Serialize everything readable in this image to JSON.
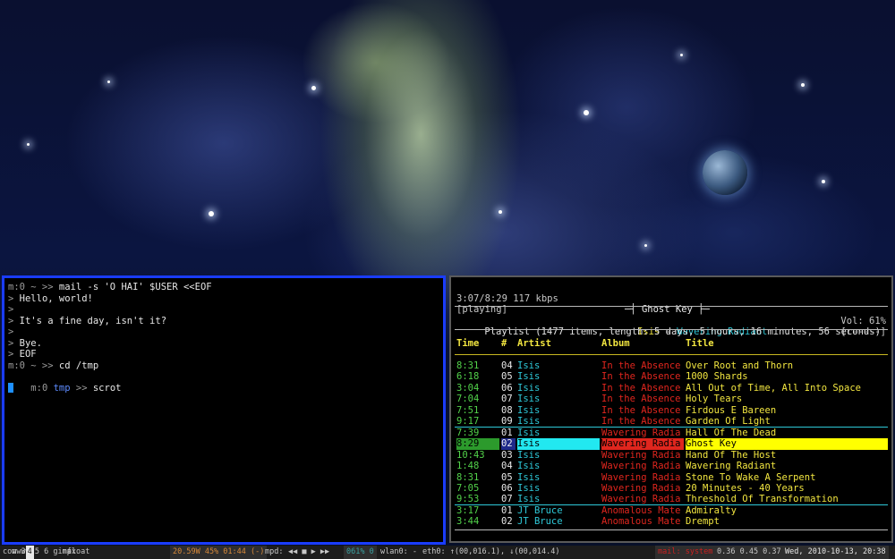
{
  "terminal": {
    "lines": [
      {
        "prompt": "m:0 ~ >> ",
        "text": "mail -s 'O HAI' $USER <<EOF"
      },
      {
        "prompt": "> ",
        "text": "Hello, world!"
      },
      {
        "prompt": ">",
        "text": ""
      },
      {
        "prompt": "> ",
        "text": "It's a fine day, isn't it?"
      },
      {
        "prompt": ">",
        "text": ""
      },
      {
        "prompt": "> ",
        "text": "Bye."
      },
      {
        "prompt": "> ",
        "text": "EOF"
      },
      {
        "prompt": "m:0 ~ >> ",
        "text": "cd /tmp"
      }
    ],
    "last_prompt_pre": "m:0 ",
    "last_prompt_dir": "tmp",
    "last_prompt_post": " >> ",
    "last_command": "scrot"
  },
  "player": {
    "elapsed": "3:07/8:29 117 kbps",
    "song_title": "─┤ Ghost Key ├─",
    "volume": "Vol: 61%",
    "state": "[playing]",
    "now_artist": "Isis",
    "now_sep": " - ",
    "now_album": "Wavering Radiant",
    "flags": "[r-----]",
    "playlist_info": "Playlist (1477 items, length: 5 days, 5 hours, 16 minutes, 56 seconds)",
    "columns": {
      "time": "Time",
      "num": "#",
      "artist": "Artist",
      "album": "Album",
      "title": "Title"
    },
    "rows": [
      {
        "time": "8:31",
        "num": "04",
        "artist": "Isis",
        "album": "In the Absence",
        "title": "Over Root and Thorn"
      },
      {
        "time": "6:18",
        "num": "05",
        "artist": "Isis",
        "album": "In the Absence",
        "title": "1000 Shards"
      },
      {
        "time": "3:04",
        "num": "06",
        "artist": "Isis",
        "album": "In the Absence",
        "title": "All Out of Time, All Into Space"
      },
      {
        "time": "7:04",
        "num": "07",
        "artist": "Isis",
        "album": "In the Absence",
        "title": "Holy Tears"
      },
      {
        "time": "7:51",
        "num": "08",
        "artist": "Isis",
        "album": "In the Absence",
        "title": "Firdous E Bareen"
      },
      {
        "time": "9:17",
        "num": "09",
        "artist": "Isis",
        "album": "In the Absence",
        "title": "Garden Of Light"
      },
      {
        "time": "7:39",
        "num": "01",
        "artist": "Isis",
        "album": "Wavering Radia",
        "title": "Hall Of The Dead"
      },
      {
        "time": "8:29",
        "num": "02",
        "artist": "Isis",
        "album": "Wavering Radia",
        "title": "Ghost Key"
      },
      {
        "time": "10:43",
        "num": "03",
        "artist": "Isis",
        "album": "Wavering Radia",
        "title": "Hand Of The Host"
      },
      {
        "time": "1:48",
        "num": "04",
        "artist": "Isis",
        "album": "Wavering Radia",
        "title": "Wavering Radiant"
      },
      {
        "time": "8:31",
        "num": "05",
        "artist": "Isis",
        "album": "Wavering Radia",
        "title": "Stone To Wake A Serpent"
      },
      {
        "time": "7:05",
        "num": "06",
        "artist": "Isis",
        "album": "Wavering Radia",
        "title": "20 Minutes - 40 Years"
      },
      {
        "time": "9:53",
        "num": "07",
        "artist": "Isis",
        "album": "Wavering Radia",
        "title": "Threshold Of Transformation"
      },
      {
        "time": "3:17",
        "num": "01",
        "artist": "JT Bruce",
        "album": "Anomalous Mate",
        "title": "Admiralty"
      },
      {
        "time": "3:44",
        "num": "02",
        "artist": "JT Bruce",
        "album": "Anomalous Mate",
        "title": "Drempt"
      }
    ],
    "progress": "════════════════════════════════════════════════════════════════════════════════════════════>"
  },
  "statusbar": {
    "tags": [
      "com",
      "www",
      "3",
      "4",
      "5",
      "6",
      "gimp",
      "max",
      "float"
    ],
    "battery": "20.59W 45% 01:44 (-)",
    "mpd_label": "mpd:",
    "mpd_controls": "◀◀ ■ ▶ ▶▶",
    "volume": "061% 0",
    "wlan": "wlan0: -",
    "eth": "eth0: ↑(00,016.1), ↓(00,014.4)",
    "mail": "mail: system",
    "load": "0.36 0.45 0.37",
    "clock": "Wed, 2010-10-13, 20:38"
  }
}
